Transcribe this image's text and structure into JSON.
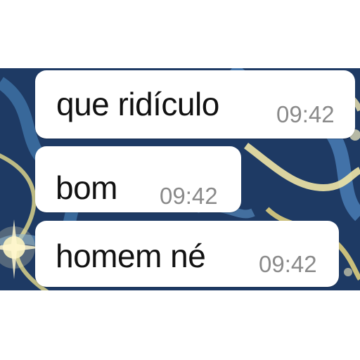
{
  "conversation": {
    "messages": [
      {
        "text": "que ridículo",
        "time": "09:42"
      },
      {
        "text": "bom",
        "time": "09:42"
      },
      {
        "text": "homem né",
        "time": "09:42"
      }
    ]
  },
  "colors": {
    "wallpaper_base": "#1f3a63",
    "wallpaper_accent": "#e8d98a",
    "bubble": "#ffffff",
    "message_text": "#111111",
    "timestamp_text": "#8a8a8a"
  }
}
